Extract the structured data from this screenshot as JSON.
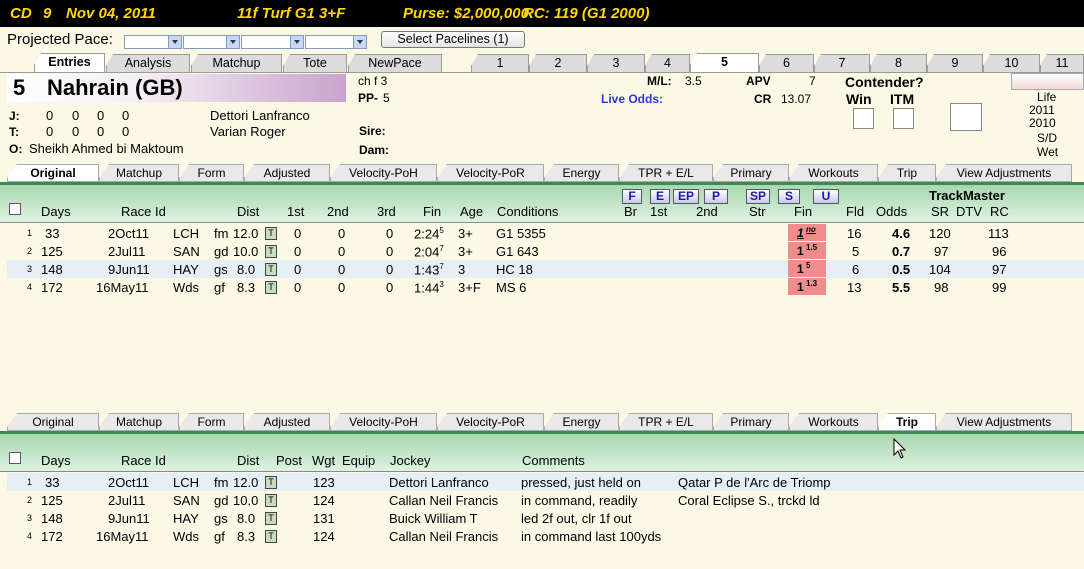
{
  "topbar": {
    "track": "CD",
    "race": "9",
    "date": "Nov 04, 2011",
    "conditions": "11f  Turf  G1  3+F",
    "purse": "Purse: $2,000,000",
    "rc": "RC: 119  (G1 2000)"
  },
  "pace": {
    "label": "Projected Pace:",
    "button": "Select Pacelines  (1)"
  },
  "main_tabs": [
    "Entries",
    "Analysis",
    "Matchup",
    "Tote",
    "NewPace"
  ],
  "race_tabs": [
    "1",
    "2",
    "3",
    "4",
    "5",
    "6",
    "7",
    "8",
    "9",
    "10",
    "11"
  ],
  "horse": {
    "number": "5",
    "name": "Nahrain (GB)",
    "sex_age": "ch f 3",
    "pp_label": "PP-",
    "pp": "5",
    "j_label": "J:",
    "t_label": "T:",
    "o_label": "O:",
    "j_stats": [
      "0",
      "0",
      "0",
      "0"
    ],
    "t_stats": [
      "0",
      "0",
      "0",
      "0"
    ],
    "jockey": "Dettori Lanfranco",
    "trainer": "Varian Roger",
    "owner": "Sheikh Ahmed bi Maktoum",
    "sire_label": "Sire:",
    "dam_label": "Dam:",
    "ml_label": "M/L:",
    "ml": "3.5",
    "live_odds_label": "Live Odds:",
    "apv_label": "APV",
    "apv": "7",
    "cr_label": "CR",
    "cr": "13.07",
    "contender_label": "Contender?",
    "win_label": "Win",
    "itm_label": "ITM",
    "records": [
      "Life",
      "2011",
      "2010",
      "S/D",
      "Wet"
    ]
  },
  "sub_tabs": [
    "Original",
    "Matchup",
    "Form",
    "Adjusted",
    "Velocity-PoH",
    "Velocity-PoR",
    "Energy",
    "TPR + E/L",
    "Primary",
    "Workouts",
    "Trip",
    "View Adjustments"
  ],
  "upper": {
    "seg_buttons": [
      "F",
      "E",
      "EP",
      "P",
      "SP",
      "S",
      "U"
    ],
    "trackmaster": "TrackMaster",
    "headers": {
      "days": "Days",
      "race_id": "Race Id",
      "dist": "Dist",
      "c1st": "1st",
      "c2nd": "2nd",
      "c3rd": "3rd",
      "fin": "Fin",
      "age": "Age",
      "conditions": "Conditions",
      "br": "Br",
      "s1st": "1st",
      "s2nd": "2nd",
      "str": "Str",
      "sfin": "Fin",
      "fld": "Fld",
      "odds": "Odds",
      "sr": "SR",
      "dtv": "DTV",
      "rc": "RC"
    },
    "rows": [
      {
        "n": "1",
        "days": "33",
        "date": "2Oct11",
        "trk": "LCH",
        "sfc": "fm",
        "dist": "12.0",
        "t": "T",
        "c1": "0",
        "c2": "0",
        "c3": "0",
        "time": "2:24",
        "tf": "5",
        "age": "3+",
        "cond": "G1 5355",
        "fin": "1",
        "finsup": "no",
        "fld": "16",
        "odds": "4.6",
        "sr": "120",
        "rc": "113"
      },
      {
        "n": "2",
        "days": "125",
        "date": "2Jul11",
        "trk": "SAN",
        "sfc": "gd",
        "dist": "10.0",
        "t": "T",
        "c1": "0",
        "c2": "0",
        "c3": "0",
        "time": "2:04",
        "tf": "7",
        "age": "3+",
        "cond": "G1 643",
        "fin": "1",
        "finsup": "1.5",
        "fld": "5",
        "odds": "0.7",
        "sr": "97",
        "rc": "96"
      },
      {
        "n": "3",
        "days": "148",
        "date": "9Jun11",
        "trk": "HAY",
        "sfc": "gs",
        "dist": "8.0",
        "t": "T",
        "c1": "0",
        "c2": "0",
        "c3": "0",
        "time": "1:43",
        "tf": "7",
        "age": "3",
        "cond": "HC 18",
        "fin": "1",
        "finsup": "5",
        "fld": "6",
        "odds": "0.5",
        "sr": "104",
        "rc": "97"
      },
      {
        "n": "4",
        "days": "172",
        "date": "16May11",
        "trk": "Wds",
        "sfc": "gf",
        "dist": "8.3",
        "t": "T",
        "c1": "0",
        "c2": "0",
        "c3": "0",
        "time": "1:44",
        "tf": "3",
        "age": "3+F",
        "cond": "MS 6",
        "fin": "1",
        "finsup": "1.3",
        "fld": "13",
        "odds": "5.5",
        "sr": "98",
        "rc": "99"
      }
    ]
  },
  "lower": {
    "headers": {
      "days": "Days",
      "race_id": "Race Id",
      "dist": "Dist",
      "post": "Post",
      "wgt": "Wgt",
      "equip": "Equip",
      "jockey": "Jockey",
      "comments": "Comments"
    },
    "rows": [
      {
        "n": "1",
        "days": "33",
        "date": "2Oct11",
        "trk": "LCH",
        "sfc": "fm",
        "dist": "12.0",
        "t": "T",
        "wgt": "123",
        "jockey": "Dettori Lanfranco",
        "comment": "pressed, just held on",
        "race": "Qatar P de l'Arc de Triomp"
      },
      {
        "n": "2",
        "days": "125",
        "date": "2Jul11",
        "trk": "SAN",
        "sfc": "gd",
        "dist": "10.0",
        "t": "T",
        "wgt": "124",
        "jockey": "Callan Neil Francis",
        "comment": "in command, readily",
        "race": "Coral Eclipse S., trckd ld"
      },
      {
        "n": "3",
        "days": "148",
        "date": "9Jun11",
        "trk": "HAY",
        "sfc": "gs",
        "dist": "8.0",
        "t": "T",
        "wgt": "131",
        "jockey": "Buick William T",
        "comment": "led 2f out, clr 1f out",
        "race": ""
      },
      {
        "n": "4",
        "days": "172",
        "date": "16May11",
        "trk": "Wds",
        "sfc": "gf",
        "dist": "8.3",
        "t": "T",
        "wgt": "124",
        "jockey": "Callan Neil Francis",
        "comment": "in command last 100yds",
        "race": ""
      }
    ]
  },
  "colors": {
    "topbar_bg": "#000000",
    "topbar_text": "#ffd800",
    "fin_highlight": "#f08c8c",
    "header_green": "#a7d7b0"
  }
}
